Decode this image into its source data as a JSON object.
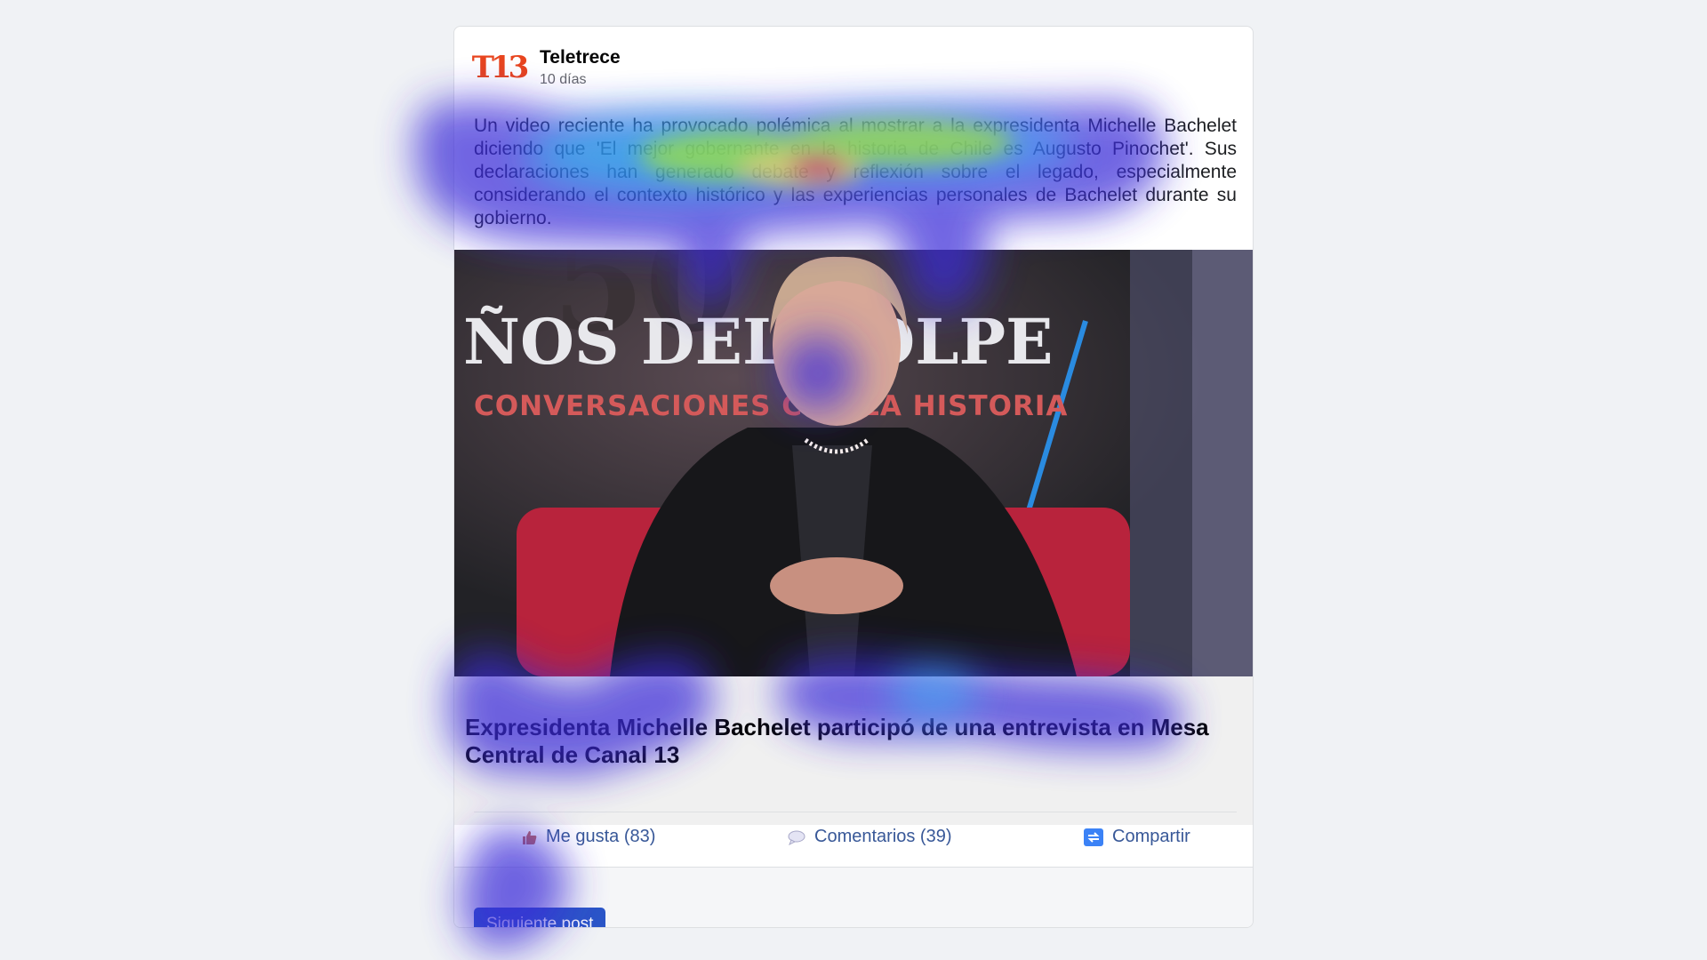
{
  "post": {
    "page_name": "Teletrece",
    "logo_text": "T13",
    "time": "10 días",
    "text": "Un video reciente ha provocado polémica al mostrar a la expresidenta Michelle Bachelet diciendo que 'El mejor gobernante en la historia de Chile es Augusto Pinochet'. Sus declaraciones han generado debate y reflexión sobre el legado, especialmente considerando el contexto histórico y las experiencias personales de Bachelet durante su gobierno.",
    "image": {
      "backdrop_line1": "ÑOS DEL GOLPE",
      "backdrop_line2": "CONVERSACIONES CON LA HISTORIA",
      "backdrop_number": "50"
    },
    "link_title": "Expresidenta Michelle Bachelet participó de una entrevista en Mesa Central de Canal 13"
  },
  "actions": {
    "like": "Me gusta (83)",
    "comments": "Comentarios (39)",
    "share": "Compartir"
  },
  "footer": {
    "next_button": "Siguiente post"
  },
  "colors": {
    "accent": "#385898",
    "button": "#2b56c7",
    "logo": "#e8451e"
  }
}
